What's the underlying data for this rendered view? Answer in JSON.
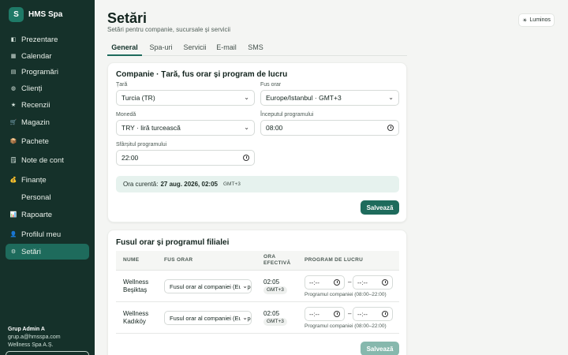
{
  "brand": {
    "logo_letter": "S",
    "name": "HMS Spa"
  },
  "nav": [
    {
      "label": "Prezentare",
      "icon": "◧",
      "icon_name": "dashboard-icon"
    },
    {
      "label": "Calendar",
      "icon": "▦",
      "icon_name": "calendar-icon"
    },
    {
      "label": "Programări",
      "icon": "▤",
      "icon_name": "appointments-icon"
    },
    {
      "label": "Clienți",
      "icon": "◍",
      "icon_name": "clients-icon"
    },
    {
      "label": "Recenzii",
      "icon": "★",
      "icon_name": "star-icon"
    },
    {
      "label": "Magazin",
      "icon": "🛒",
      "icon_name": "cart-icon"
    },
    {
      "label": "Pachete",
      "icon": "📦",
      "icon_name": "package-icon"
    },
    {
      "label": "Note de cont",
      "icon": "🗒",
      "icon_name": "notes-icon"
    },
    {
      "label": "Finanțe",
      "icon": "💰",
      "icon_name": "money-bag-icon"
    },
    {
      "label": "Personal",
      "icon": "",
      "icon_name": "staff-icon"
    },
    {
      "label": "Rapoarte",
      "icon": "📊",
      "icon_name": "chart-icon"
    },
    {
      "label": "Profilul meu",
      "icon": "👤",
      "icon_name": "user-icon"
    },
    {
      "label": "Setări",
      "icon": "⚙",
      "icon_name": "gear-icon",
      "active": true
    }
  ],
  "user": {
    "name": "Grup Admin A",
    "email": "grup.a@hmsspa.com",
    "company": "Wellness Spa A.Ș."
  },
  "header": {
    "title": "Setări",
    "subtitle": "Setări pentru companie, sucursale și servicii",
    "theme_label": "Luminos",
    "theme_icon": "☀"
  },
  "tabs": [
    "General",
    "Spa-uri",
    "Servicii",
    "E-mail",
    "SMS"
  ],
  "company_card": {
    "title": "Companie · Țară, fus orar și program de lucru",
    "country_label": "Țară",
    "country_value": "Turcia (TR)",
    "timezone_label": "Fus orar",
    "timezone_value": "Europe/Istanbul · GMT+3",
    "currency_label": "Monedă",
    "currency_value": "TRY · liră turcească",
    "start_label": "Începutul programului",
    "start_value": "08:00",
    "end_label": "Sfârșitul programului",
    "end_value": "22:00",
    "current_time_label": "Ora curentă:",
    "current_time_value": "27 aug. 2026, 02:05",
    "current_time_tz": "GMT+3",
    "save_label": "Salvează"
  },
  "branch_card": {
    "title": "Fusul orar și programul filialei",
    "columns": [
      "NUME",
      "FUS ORAR",
      "ORA EFECTIVĂ",
      "PROGRAM DE LUCRU"
    ],
    "rows": [
      {
        "name": "Wellness Beşiktaş",
        "timezone": "Fusul orar al companiei (Europe/Istanbul)",
        "effective_time": "02:05",
        "gmt": "GMT+3",
        "from": "--:--",
        "to": "--:--",
        "hint": "Programul companiei (08:00–22:00)"
      },
      {
        "name": "Wellness Kadıköy",
        "timezone": "Fusul orar al companiei (Europe/Istanbul)",
        "effective_time": "02:05",
        "gmt": "GMT+3",
        "from": "--:--",
        "to": "--:--",
        "hint": "Programul companiei (08:00–22:00)"
      }
    ],
    "dash": "–",
    "save_label": "Salvează"
  }
}
